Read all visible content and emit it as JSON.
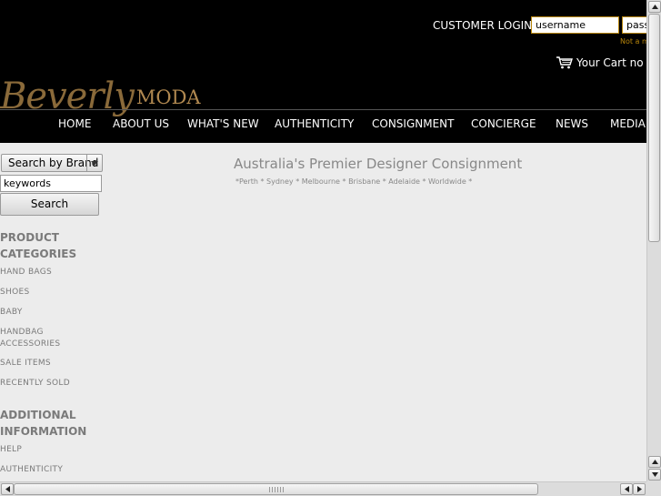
{
  "header": {
    "login_label": "CUSTOMER LOGIN",
    "username_value": "username",
    "password_value": "password",
    "not_member_text": "Not a member?",
    "cart_text": "Your Cart no items",
    "logo_script": "Beverly",
    "logo_moda": "MODA"
  },
  "nav": {
    "items": [
      "HOME",
      "ABOUT US",
      "WHAT'S NEW",
      "AUTHENTICITY",
      "CONSIGNMENT",
      "CONCIERGE",
      "NEWS",
      "MEDIA"
    ]
  },
  "search": {
    "select_value": "Search by Brand",
    "keywords_value": "keywords",
    "button_label": "Search"
  },
  "main": {
    "tagline": "Australia's Premier Designer Consignment",
    "locations": "*Perth * Sydney * Melbourne * Brisbane * Adelaide * Worldwide *"
  },
  "sidebar": {
    "product_heading_1": "PRODUCT",
    "product_heading_2": "CATEGORIES",
    "categories": [
      "HAND BAGS",
      "SHOES",
      "BABY",
      "HANDBAG",
      "ACCESSORIES",
      "SALE ITEMS",
      "RECENTLY SOLD"
    ],
    "info_heading_1": "ADDITIONAL",
    "info_heading_2": "INFORMATION",
    "info_links": [
      "HELP",
      "AUTHENTICITY"
    ]
  },
  "icons": {
    "cart": "shopping-cart-icon",
    "select_arrow": "triangle-down-icon",
    "scroll_up": "arrow-up-icon",
    "scroll_down": "arrow-down-icon",
    "scroll_left": "arrow-left-icon",
    "scroll_right": "arrow-right-icon"
  },
  "colors": {
    "header_bg": "#000000",
    "accent_gold": "#b8860b",
    "page_bg": "#ececec",
    "text_gray": "#7a7a7a"
  }
}
